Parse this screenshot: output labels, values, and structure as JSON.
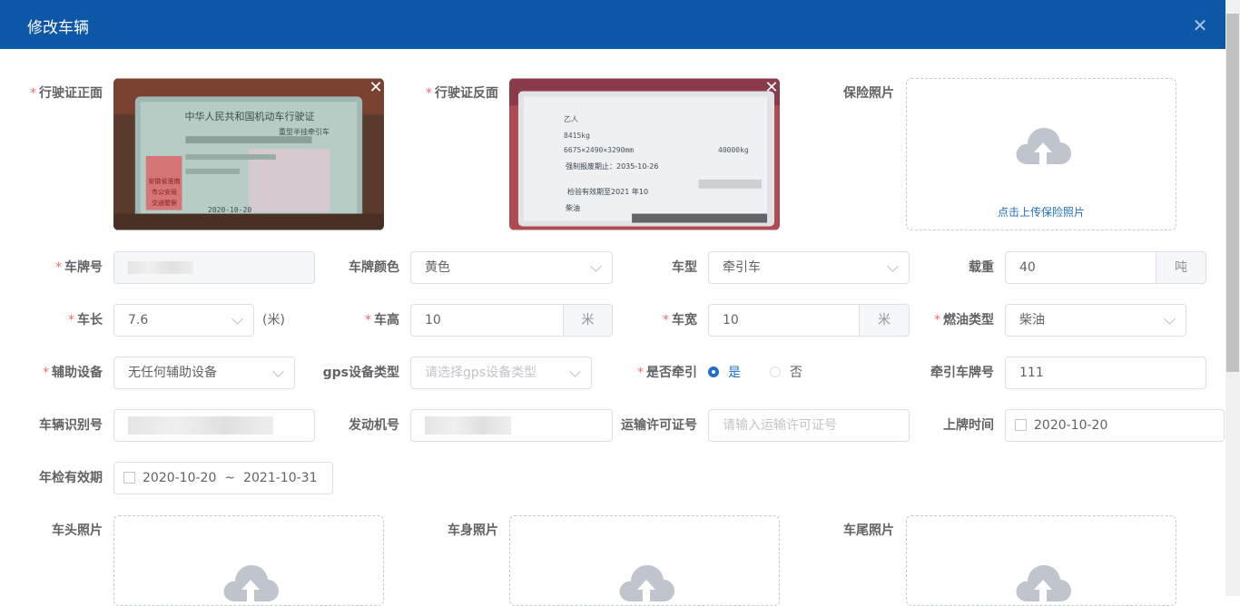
{
  "dialog": {
    "title": "修改车辆",
    "close_icon": "close-icon"
  },
  "photos": {
    "license_front": {
      "label": "行驶证正面",
      "card_title": "中华人民共和国机动车行驶证",
      "card_subtitle": "重型半挂牵引车",
      "card_date": "2020-10-20",
      "stamp": [
        "安徽省淮南",
        "市公安局",
        "交通警察"
      ]
    },
    "license_back": {
      "label": "行驶证反面",
      "lines": [
        "乙人",
        "8415kg",
        "6675×2490×3290mm",
        "40000kg",
        "强制报废期止：2035-10-26",
        "检验有效期至2021 年10",
        "柴油"
      ]
    },
    "insurance": {
      "label": "保险照片",
      "upload_text": "点击上传保险照片"
    },
    "head": {
      "label": "车头照片"
    },
    "body": {
      "label": "车身照片"
    },
    "tail": {
      "label": "车尾照片"
    }
  },
  "form": {
    "plate_no": {
      "label": "车牌号"
    },
    "plate_color": {
      "label": "车牌颜色",
      "value": "黄色"
    },
    "vehicle_type": {
      "label": "车型",
      "value": "牵引车"
    },
    "load": {
      "label": "载重",
      "value": "40",
      "unit": "吨"
    },
    "length": {
      "label": "车长",
      "value": "7.6",
      "unit": "(米)"
    },
    "height": {
      "label": "车高",
      "value": "10",
      "unit": "米"
    },
    "width": {
      "label": "车宽",
      "value": "10",
      "unit": "米"
    },
    "fuel_type": {
      "label": "燃油类型",
      "value": "柴油"
    },
    "aux_equipment": {
      "label": "辅助设备",
      "value": "无任何辅助设备"
    },
    "gps_type": {
      "label": "gps设备类型",
      "placeholder": "请选择gps设备类型"
    },
    "is_traction": {
      "label": "是否牵引",
      "options": [
        "是",
        "否"
      ],
      "selected": "是"
    },
    "traction_plate": {
      "label": "牵引车牌号",
      "value": "111"
    },
    "vin": {
      "label": "车辆识别号"
    },
    "engine_no": {
      "label": "发动机号"
    },
    "transport_permit": {
      "label": "运输许可证号",
      "placeholder": "请输入运输许可证号"
    },
    "register_date": {
      "label": "上牌时间",
      "value": "2020-10-20"
    },
    "inspection_valid": {
      "label": "年检有效期",
      "start": "2020-10-20",
      "separator": "~",
      "end": "2021-10-31"
    }
  },
  "colors": {
    "header": "#0d57a7",
    "accent": "#1f6fc5",
    "required": "#f56c6c",
    "border": "#dcdfe6"
  }
}
